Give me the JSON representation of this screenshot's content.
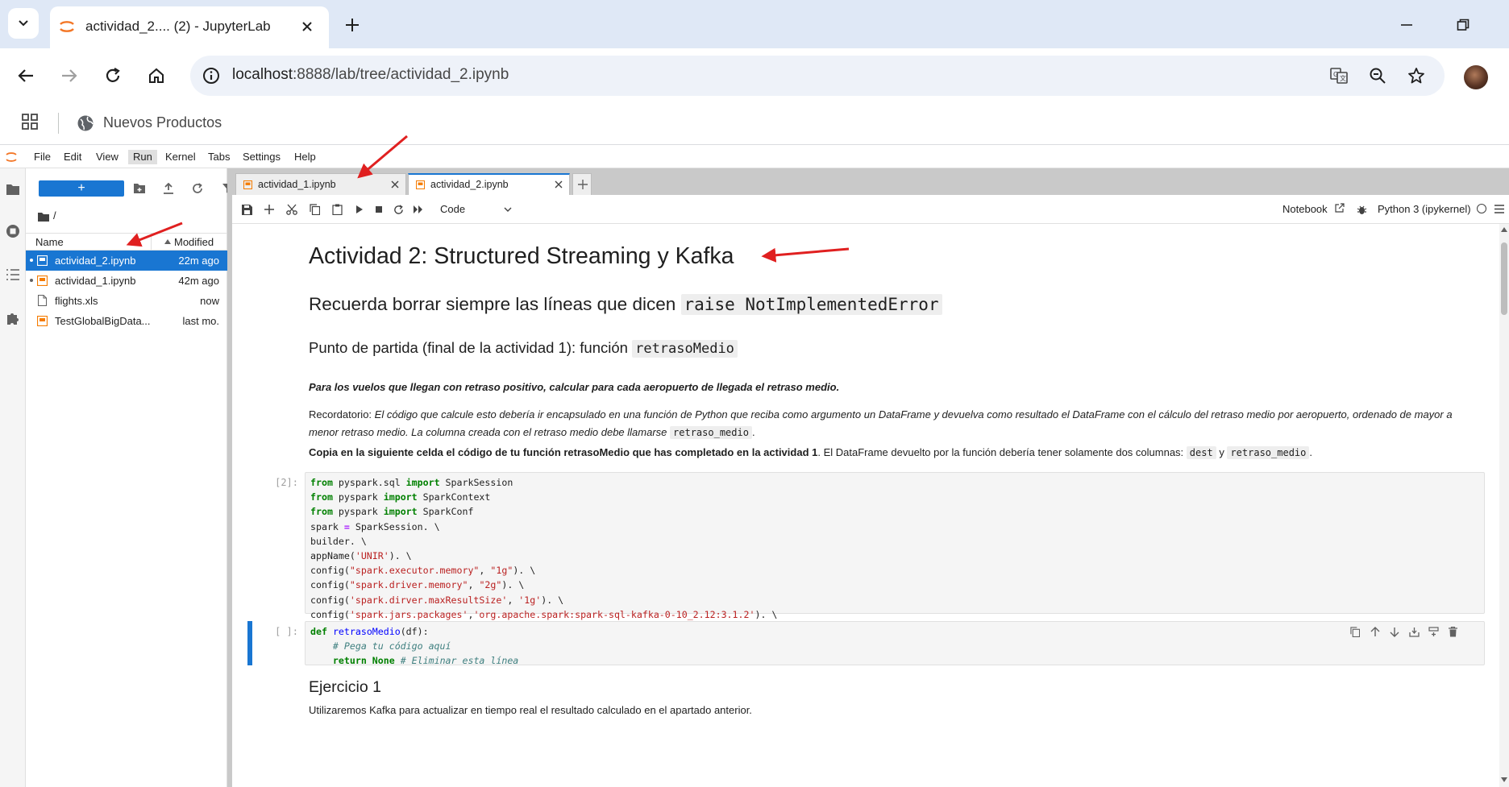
{
  "browser": {
    "tab_title": "actividad_2.... (2) - JupyterLab",
    "url_host": "localhost",
    "url_rest": ":8888/lab/tree/actividad_2.ipynb",
    "bookmark": "Nuevos Productos"
  },
  "menu": [
    "File",
    "Edit",
    "View",
    "Run",
    "Kernel",
    "Tabs",
    "Settings",
    "Help"
  ],
  "filebrowser": {
    "new_label": "+",
    "path": "/",
    "col_name": "Name",
    "col_modified": "Modified",
    "files": [
      {
        "name": "actividad_2.ipynb",
        "modified": "22m ago",
        "type": "notebook",
        "selected": true,
        "running": true
      },
      {
        "name": "actividad_1.ipynb",
        "modified": "42m ago",
        "type": "notebook",
        "selected": false,
        "running": true
      },
      {
        "name": "flights.xls",
        "modified": "now",
        "type": "file",
        "selected": false,
        "running": false
      },
      {
        "name": "TestGlobalBigData...",
        "modified": "last mo.",
        "type": "notebook",
        "selected": false,
        "running": false
      }
    ]
  },
  "doc_tabs": [
    {
      "label": "actividad_1.ipynb",
      "active": false
    },
    {
      "label": "actividad_2.ipynb",
      "active": true
    }
  ],
  "toolbar": {
    "cell_type": "Code",
    "notebook_label": "Notebook",
    "kernel": "Python 3 (ipykernel)"
  },
  "notebook": {
    "h1": "Actividad 2: Structured Streaming y Kafka",
    "h2_text": "Recuerda borrar siempre las líneas que dicen",
    "h2_code": "raise NotImplementedError",
    "h3_text": "Punto de partida (final de la actividad 1): función",
    "h3_code": "retrasoMedio",
    "p1": "Para los vuelos que llegan con retraso positivo, calcular para cada aeropuerto de llegada el retraso medio.",
    "p2_lead": "Recordatorio:",
    "p2_italic": "El código que calcule esto debería ir encapsulado en una función de Python que reciba como argumento un DataFrame y devuelva como resultado el DataFrame con el cálculo del retraso medio por aeropuerto, ordenado de mayor a menor retraso medio. La columna creada con el retraso medio debe llamarse",
    "p2_code": "retraso_medio",
    "p2_end": ".",
    "p3_bold": "Copia en la siguiente celda el código de tu función retrasoMedio que has completado en la actividad 1",
    "p3_rest": ". El DataFrame devuelto por la función debería tener solamente dos columnas:",
    "p3_code1": "dest",
    "p3_y": "y",
    "p3_code2": "retraso_medio",
    "p3_end": ".",
    "cell1_prompt": "[2]:",
    "cell2_prompt": "[ ]:",
    "h2b": "Ejercicio 1",
    "p4": "Utilizaremos Kafka para actualizar en tiempo real el resultado calculado en el apartado anterior."
  },
  "colors": {
    "accent": "#1976d2",
    "annotation_arrow": "#e02020",
    "chrome_tabbar": "#dfe8f6"
  }
}
